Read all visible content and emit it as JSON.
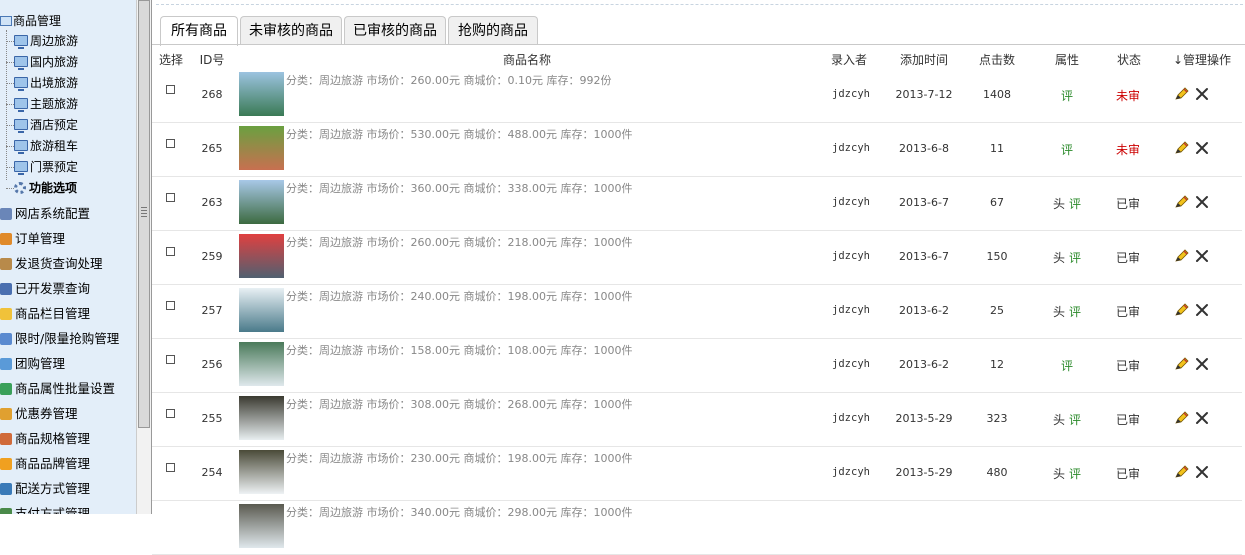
{
  "sidebar": {
    "root_label": "商品管理",
    "tree_children": [
      {
        "label": "周边旅游",
        "icon": "monitor-icon"
      },
      {
        "label": "国内旅游",
        "icon": "monitor-icon"
      },
      {
        "label": "出境旅游",
        "icon": "monitor-icon"
      },
      {
        "label": "主题旅游",
        "icon": "monitor-icon"
      },
      {
        "label": "酒店预定",
        "icon": "monitor-icon"
      },
      {
        "label": "旅游租车",
        "icon": "monitor-icon"
      },
      {
        "label": "门票预定",
        "icon": "monitor-icon"
      }
    ],
    "feature_label": "功能选项",
    "items": [
      {
        "label": "网店系统配置",
        "icon": "tools-icon",
        "color": "#6a86b8"
      },
      {
        "label": "订单管理",
        "icon": "order-icon",
        "color": "#e08a2a"
      },
      {
        "label": "发退货查询处理",
        "icon": "box-icon",
        "color": "#b88a4a"
      },
      {
        "label": "已开发票查询",
        "icon": "invoice-icon",
        "color": "#4a6fb0"
      },
      {
        "label": "商品栏目管理",
        "icon": "folder-icon",
        "color": "#f0c23a"
      },
      {
        "label": "限时/限量抢购管理",
        "icon": "clock-icon",
        "color": "#5a8ad0"
      },
      {
        "label": "团购管理",
        "icon": "group-icon",
        "color": "#5a9ad8"
      },
      {
        "label": "商品属性批量设置",
        "icon": "chart-icon",
        "color": "#3aa05a"
      },
      {
        "label": "优惠券管理",
        "icon": "coupon-icon",
        "color": "#e0a030"
      },
      {
        "label": "商品规格管理",
        "icon": "wrench-icon",
        "color": "#d06a3a"
      },
      {
        "label": "商品品牌管理",
        "icon": "star-icon",
        "color": "#f0a020"
      },
      {
        "label": "配送方式管理",
        "icon": "delivery-icon",
        "color": "#3a7ab8"
      },
      {
        "label": "支付方式管理",
        "icon": "payment-icon",
        "color": "#4a8a4a"
      }
    ]
  },
  "tabs": [
    "所有商品",
    "未审核的商品",
    "已审核的商品",
    "抢购的商品"
  ],
  "table": {
    "headers": {
      "select": "选择",
      "id": "ID号",
      "name": "商品名称",
      "user": "录入者",
      "time": "添加时间",
      "clicks": "点击数",
      "attr": "属性",
      "status": "状态",
      "actions": "↓管理操作"
    },
    "rows": [
      {
        "id": "268",
        "desc": "分类：周边旅游 市场价：260.00元 商城价：0.10元 库存：992份",
        "user": "jdzcyh",
        "date": "2013-7-12",
        "clicks": "1408",
        "head": "",
        "eval": "评",
        "status": "未审",
        "status_kind": "pending",
        "thumb_top": "#9cc3e0",
        "thumb_bottom": "#3a7a55"
      },
      {
        "id": "265",
        "desc": "分类：周边旅游 市场价：530.00元 商城价：488.00元 库存：1000件",
        "user": "jdzcyh",
        "date": "2013-6-8",
        "clicks": "11",
        "head": "",
        "eval": "评",
        "status": "未审",
        "status_kind": "pending",
        "thumb_top": "#6aa040",
        "thumb_bottom": "#c87050"
      },
      {
        "id": "263",
        "desc": "分类：周边旅游 市场价：360.00元 商城价：338.00元 库存：1000件",
        "user": "jdzcyh",
        "date": "2013-6-7",
        "clicks": "67",
        "head": "头",
        "eval": "评",
        "status": "已审",
        "status_kind": "done",
        "thumb_top": "#a8c8e8",
        "thumb_bottom": "#3c6a40"
      },
      {
        "id": "259",
        "desc": "分类：周边旅游 市场价：260.00元 商城价：218.00元 库存：1000件",
        "user": "jdzcyh",
        "date": "2013-6-7",
        "clicks": "150",
        "head": "头",
        "eval": "评",
        "status": "已审",
        "status_kind": "done",
        "thumb_top": "#e04040",
        "thumb_bottom": "#506070"
      },
      {
        "id": "257",
        "desc": "分类：周边旅游 市场价：240.00元 商城价：198.00元 库存：1000件",
        "user": "jdzcyh",
        "date": "2013-6-2",
        "clicks": "25",
        "head": "头",
        "eval": "评",
        "status": "已审",
        "status_kind": "done",
        "thumb_top": "#e8f0f4",
        "thumb_bottom": "#4a7a8a"
      },
      {
        "id": "256",
        "desc": "分类：周边旅游 市场价：158.00元 商城价：108.00元 库存：1000件",
        "user": "jdzcyh",
        "date": "2013-6-2",
        "clicks": "12",
        "head": "",
        "eval": "评",
        "status": "已审",
        "status_kind": "done",
        "thumb_top": "#4a7a5a",
        "thumb_bottom": "#dfe8ec"
      },
      {
        "id": "255",
        "desc": "分类：周边旅游 市场价：308.00元 商城价：268.00元 库存：1000件",
        "user": "jdzcyh",
        "date": "2013-5-29",
        "clicks": "323",
        "head": "头",
        "eval": "评",
        "status": "已审",
        "status_kind": "done",
        "thumb_top": "#3a3a30",
        "thumb_bottom": "#e8eef0"
      },
      {
        "id": "254",
        "desc": "分类：周边旅游 市场价：230.00元 商城价：198.00元 库存：1000件",
        "user": "jdzcyh",
        "date": "2013-5-29",
        "clicks": "480",
        "head": "头",
        "eval": "评",
        "status": "已审",
        "status_kind": "done",
        "thumb_top": "#4a4a38",
        "thumb_bottom": "#eef2f4"
      },
      {
        "id": "",
        "desc": "分类：周边旅游 市场价：340.00元 商城价：298.00元 库存：1000件",
        "user": "",
        "date": "",
        "clicks": "",
        "head": "",
        "eval": "",
        "status": "",
        "status_kind": "done",
        "thumb_top": "#5a5a50",
        "thumb_bottom": "#e0e8ec"
      }
    ]
  }
}
